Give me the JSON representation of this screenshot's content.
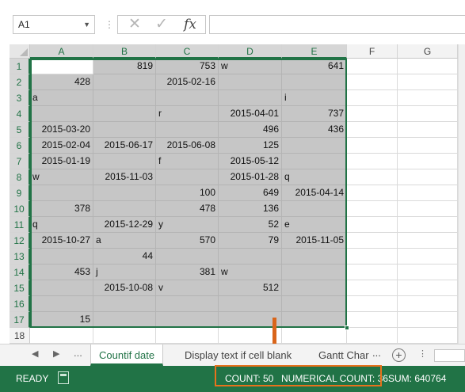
{
  "formula_bar": {
    "name_box": "A1",
    "name_box_dropdown_icon": "chevron-down-icon",
    "separator": "⋮",
    "cancel_icon": "✕",
    "enter_icon": "✓",
    "fx_label": "fx",
    "formula": ""
  },
  "columns": [
    "A",
    "B",
    "C",
    "D",
    "E",
    "F",
    "G"
  ],
  "selected_columns": [
    "A",
    "B",
    "C",
    "D",
    "E"
  ],
  "rows": [
    {
      "num": "1",
      "cells": [
        "",
        "819",
        "753",
        "w",
        "641"
      ]
    },
    {
      "num": "2",
      "cells": [
        "428",
        "",
        "2015-02-16",
        "",
        ""
      ]
    },
    {
      "num": "3",
      "cells": [
        "a",
        "",
        "",
        "",
        "i"
      ]
    },
    {
      "num": "4",
      "cells": [
        "",
        "",
        "r",
        "2015-04-01",
        "737"
      ]
    },
    {
      "num": "5",
      "cells": [
        "2015-03-20",
        "",
        "",
        "496",
        "436"
      ]
    },
    {
      "num": "6",
      "cells": [
        "2015-02-04",
        "2015-06-17",
        "2015-06-08",
        "125",
        ""
      ]
    },
    {
      "num": "7",
      "cells": [
        "2015-01-19",
        "",
        "f",
        "2015-05-12",
        ""
      ]
    },
    {
      "num": "8",
      "cells": [
        "w",
        "2015-11-03",
        "",
        "2015-01-28",
        "q"
      ]
    },
    {
      "num": "9",
      "cells": [
        "",
        "",
        "100",
        "649",
        "2015-04-14"
      ]
    },
    {
      "num": "10",
      "cells": [
        "378",
        "",
        "478",
        "136",
        ""
      ]
    },
    {
      "num": "11",
      "cells": [
        "q",
        "2015-12-29",
        "y",
        "52",
        "e"
      ]
    },
    {
      "num": "12",
      "cells": [
        "2015-10-27",
        "a",
        "570",
        "79",
        "2015-11-05"
      ]
    },
    {
      "num": "13",
      "cells": [
        "",
        "44",
        "",
        "",
        ""
      ]
    },
    {
      "num": "14",
      "cells": [
        "453",
        "j",
        "381",
        "w",
        ""
      ]
    },
    {
      "num": "15",
      "cells": [
        "",
        "2015-10-08",
        "v",
        "512",
        ""
      ]
    },
    {
      "num": "16",
      "cells": [
        "",
        "",
        "",
        "",
        ""
      ]
    },
    {
      "num": "17",
      "cells": [
        "15",
        "",
        "",
        "",
        ""
      ]
    },
    {
      "num": "18",
      "cells": [
        "",
        "",
        "",
        "",
        ""
      ]
    }
  ],
  "tabs": {
    "prev_icon": "◀",
    "next_icon": "▶",
    "ellipsis_left": "...",
    "items": [
      "Countif date",
      "Display text if cell blank",
      "Gantt Char"
    ],
    "active_index": 0,
    "ellipsis_right": "...",
    "add_icon": "+",
    "more_icon": "⋮"
  },
  "status_bar": {
    "ready": "READY",
    "count": "COUNT: 50",
    "numerical_count": "NUMERICAL COUNT: 36",
    "sum": "SUM: 640764"
  },
  "colors": {
    "excel_green": "#217346",
    "selection_fill": "#c6c6c6",
    "highlight_orange": "#e8721c"
  }
}
